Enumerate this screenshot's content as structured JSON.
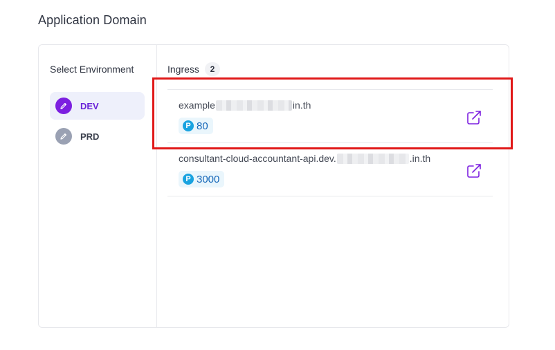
{
  "page": {
    "title": "Application Domain"
  },
  "environments": {
    "title": "Select Environment",
    "items": [
      {
        "label": "DEV",
        "active": true
      },
      {
        "label": "PRD",
        "active": false
      }
    ]
  },
  "ingress": {
    "title": "Ingress",
    "count": "2",
    "rows": [
      {
        "host_prefix": "example",
        "host_suffix": "in.th",
        "port_icon": "P",
        "port": "80"
      },
      {
        "host_prefix": "consultant-cloud-accountant-api.dev.",
        "host_suffix": ".in.th",
        "port_icon": "P",
        "port": "3000"
      }
    ]
  },
  "colors": {
    "accent": "#7c1fe0",
    "port_badge": "#1aa3e0",
    "highlight": "#e01818"
  },
  "icons": [
    "pencil-icon",
    "external-link-icon"
  ]
}
